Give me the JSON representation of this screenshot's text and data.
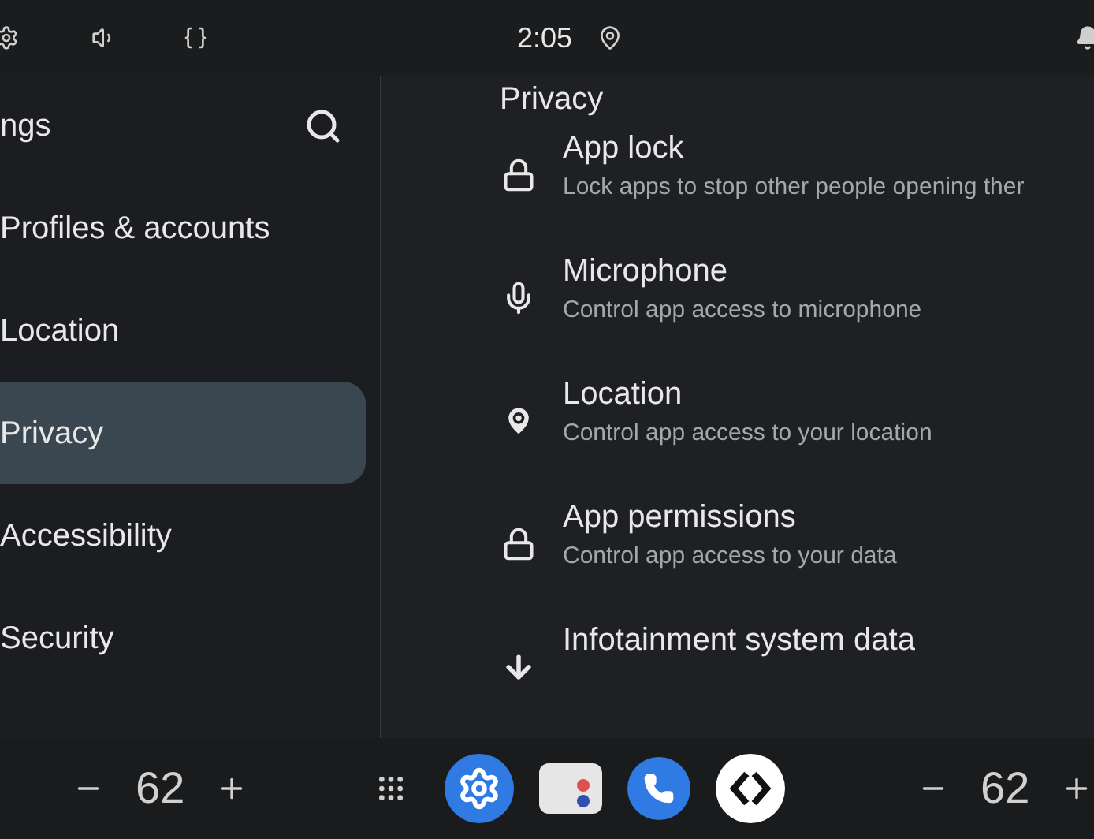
{
  "status_bar": {
    "time": "2:05"
  },
  "sidebar": {
    "title": "ngs",
    "items": [
      {
        "label": "Profiles & accounts",
        "selected": false
      },
      {
        "label": "Location",
        "selected": false
      },
      {
        "label": "Privacy",
        "selected": true
      },
      {
        "label": "Accessibility",
        "selected": false
      },
      {
        "label": "Security",
        "selected": false
      }
    ]
  },
  "content": {
    "title": "Privacy",
    "items": [
      {
        "kind": "lock",
        "title": "App lock",
        "subtitle": "Lock apps to stop other people opening ther"
      },
      {
        "kind": "mic",
        "title": "Microphone",
        "subtitle": "Control app access to microphone"
      },
      {
        "kind": "location",
        "title": "Location",
        "subtitle": "Control app access to your location"
      },
      {
        "kind": "lock",
        "title": "App permissions",
        "subtitle": "Control app access to your data"
      },
      {
        "kind": "download",
        "title": "Infotainment system data"
      }
    ]
  },
  "bottom_bar": {
    "left_temperature": "62",
    "right_temperature": "62"
  }
}
